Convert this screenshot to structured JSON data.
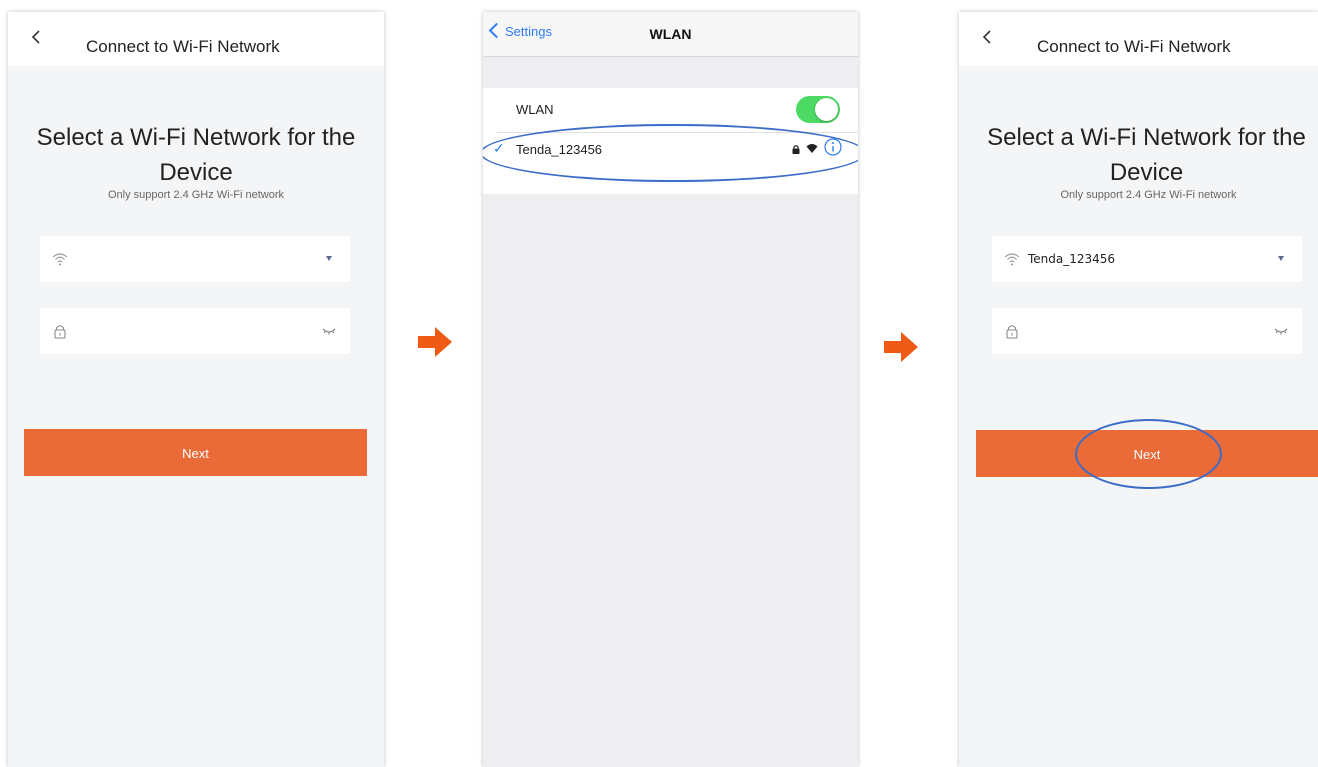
{
  "app_screen": {
    "header_title": "Connect to Wi-Fi Network",
    "heading": "Select a Wi-Fi Network for the Device",
    "subtext": "Only support 2.4 GHz Wi-Fi network",
    "next_label": "Next",
    "selected_network": "Tenda_123456"
  },
  "ios_screen": {
    "back_label": "Settings",
    "title": "WLAN",
    "wlan_label": "WLAN",
    "wlan_enabled": true,
    "network_name": "Tenda_123456"
  },
  "colors": {
    "accent_orange": "#ea6a38",
    "ios_blue": "#2d7cf6",
    "toggle_green": "#4cd964",
    "annotation_blue": "#3a6cc8"
  },
  "icons": [
    "back-arrow-icon",
    "wifi-icon",
    "lock-icon",
    "dropdown-caret-icon",
    "eye-closed-icon",
    "checkmark-icon",
    "info-icon",
    "right-arrow-icon"
  ]
}
